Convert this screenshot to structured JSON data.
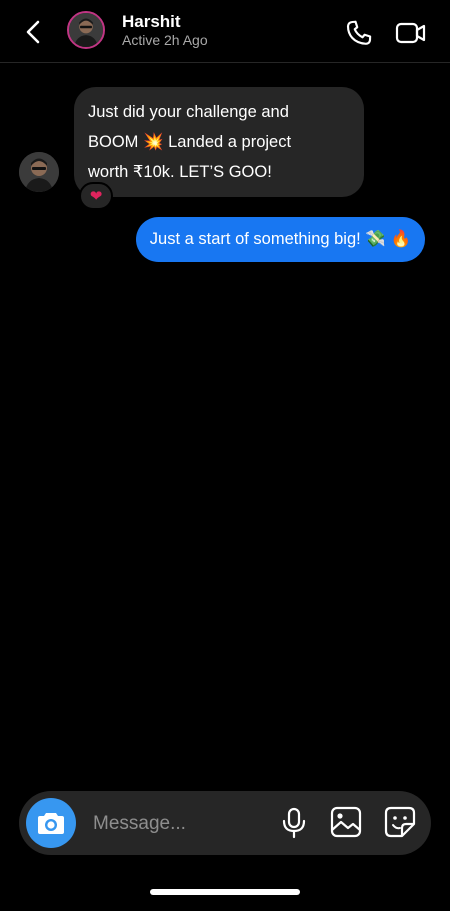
{
  "header": {
    "name": "Harshit",
    "status": "Active 2h Ago"
  },
  "messages": [
    {
      "direction": "incoming",
      "lines": [
        "Just did your challenge and",
        "BOOM 💥 Landed a project",
        "worth ₹10k. LET’S GOO!"
      ],
      "reaction": "❤"
    },
    {
      "direction": "outgoing",
      "text": "Just a start of something big! 💸 🔥"
    }
  ],
  "composer": {
    "placeholder": "Message..."
  },
  "colors": {
    "outgoing_bubble": "#1877f2",
    "incoming_bubble": "#262626",
    "camera_button": "#3797f0",
    "story_ring": "#c13584"
  },
  "icons": [
    "back-icon",
    "phone-icon",
    "video-camera-icon",
    "camera-icon",
    "microphone-icon",
    "gallery-icon",
    "sticker-icon"
  ]
}
